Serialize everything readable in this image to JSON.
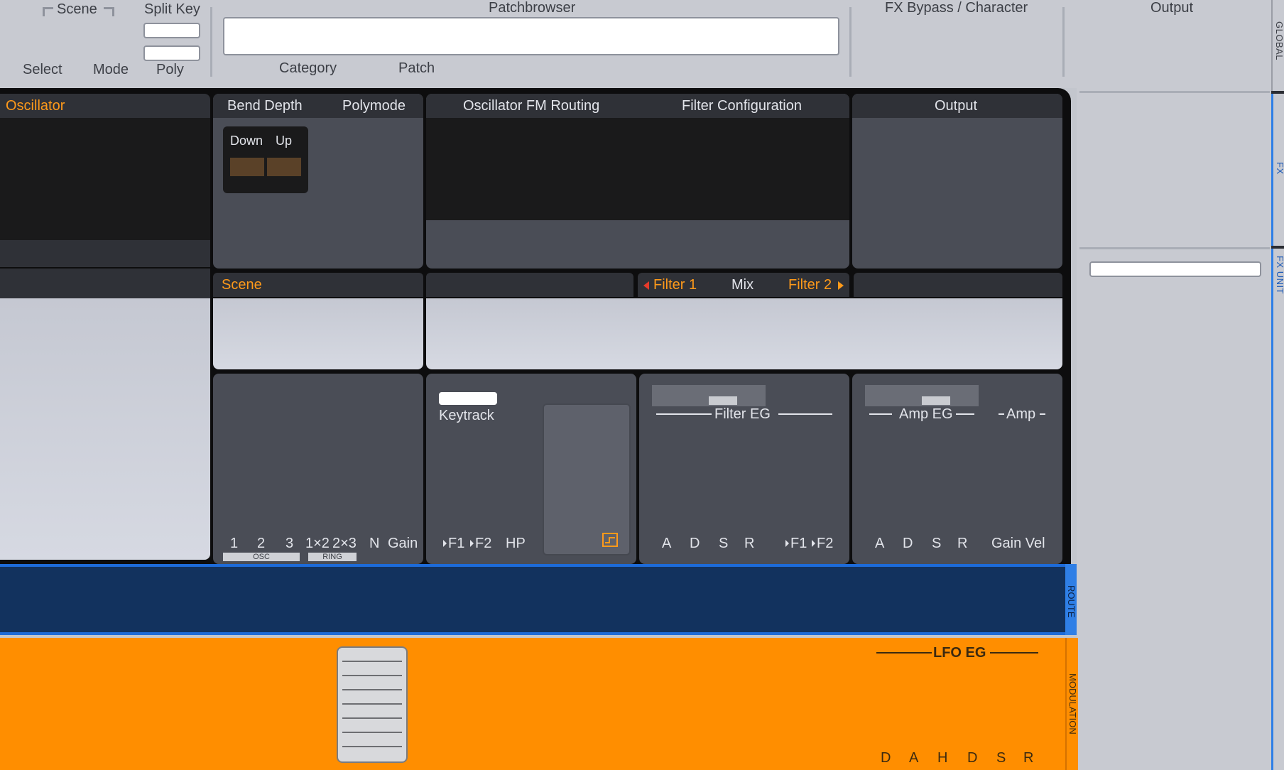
{
  "top": {
    "scene_group_label": "Scene",
    "scene_select_label": "Select",
    "scene_mode_label": "Mode",
    "split_key_label": "Split Key",
    "poly_label": "Poly",
    "patchbrowser_label": "Patchbrowser",
    "patch_field_value": "",
    "category_label": "Category",
    "patch_label": "Patch",
    "fx_bypass_label": "FX Bypass / Character",
    "output_label": "Output"
  },
  "side_tabs": {
    "global": "GLOBAL",
    "fx": "FX",
    "fx_unit": "FX UNIT",
    "route": "ROUTE",
    "modulation": "MODULATION"
  },
  "fx_unit_field_value": "",
  "panels": {
    "oscillator_title": "Oscillator",
    "bend_depth_label": "Bend Depth",
    "polymode_label": "Polymode",
    "down_label": "Down",
    "up_label": "Up",
    "osc_fm_routing_label": "Oscillator FM Routing",
    "filter_config_label": "Filter Configuration",
    "output_title": "Output",
    "scene_title": "Scene",
    "filter1_label": "Filter 1",
    "mix_label": "Mix",
    "filter2_label": "Filter 2"
  },
  "mixer": {
    "channels": [
      "1",
      "2",
      "3",
      "1×2",
      "2×3",
      "N",
      "Gain"
    ],
    "osc_badge": "OSC",
    "ring_badge": "RING"
  },
  "filter_section": {
    "keytrack_label": "Keytrack",
    "f1_label": "F1",
    "f2_label": "F2",
    "hp_label": "HP"
  },
  "filter_eg": {
    "title": "Filter EG",
    "adsr": [
      "A",
      "D",
      "S",
      "R"
    ],
    "f1_label": "F1",
    "f2_label": "F2"
  },
  "amp_eg": {
    "title": "Amp EG",
    "amp_title": "Amp",
    "adsr": [
      "A",
      "D",
      "S",
      "R"
    ],
    "gain_vel_label": "Gain Vel"
  },
  "lfo_eg": {
    "title": "LFO EG",
    "stages": [
      "D",
      "A",
      "H",
      "D",
      "S",
      "R"
    ]
  },
  "colors": {
    "accent_orange": "#ff9a1a",
    "route_blue": "#12325e",
    "modulation_orange": "#ff8e00",
    "filter1_arrow": "#e53a2a"
  }
}
